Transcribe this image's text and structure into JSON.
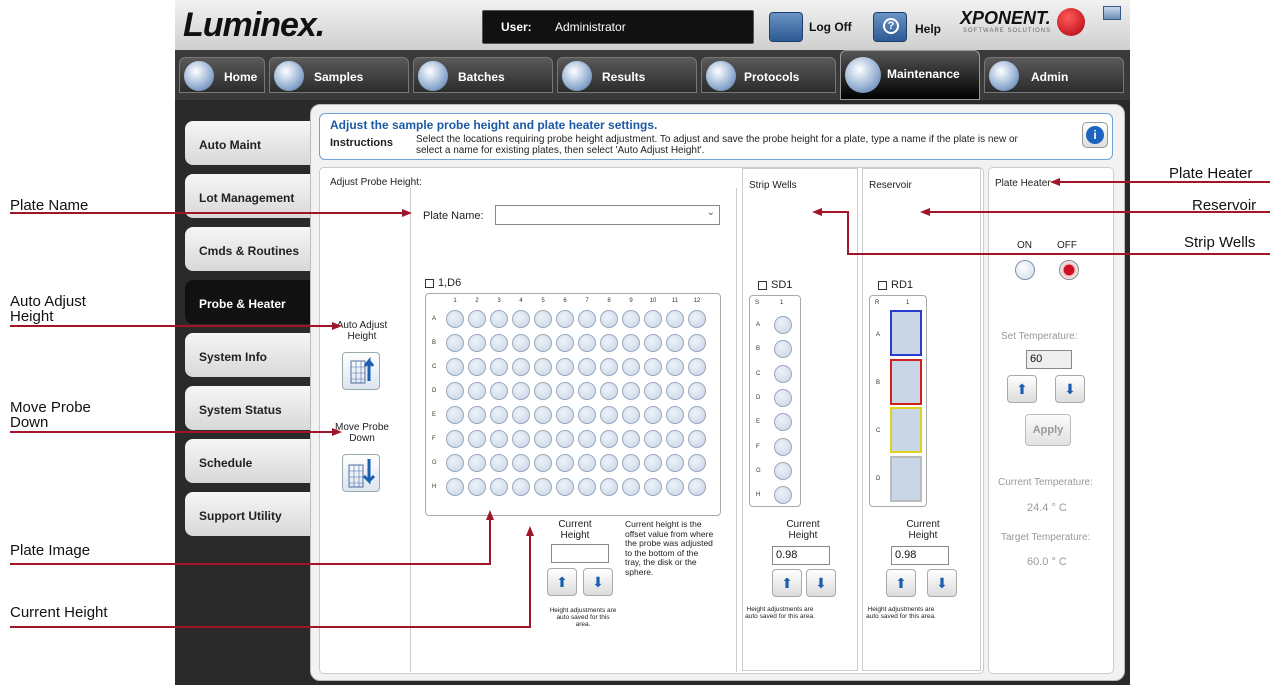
{
  "app": {
    "logo": "Luminex.",
    "brand": "XPONENT.",
    "brand_sub": "SOFTWARE SOLUTIONS"
  },
  "header": {
    "user_label": "User:",
    "user_value": "Administrator",
    "logoff": "Log Off",
    "help": "Help"
  },
  "tabs": [
    {
      "label": "Home",
      "icon": "home-icon"
    },
    {
      "label": "Samples",
      "icon": "samples-icon"
    },
    {
      "label": "Batches",
      "icon": "batches-icon"
    },
    {
      "label": "Results",
      "icon": "results-icon"
    },
    {
      "label": "Protocols",
      "icon": "protocols-icon"
    },
    {
      "label": "Maintenance",
      "icon": "maintenance-icon",
      "active": true
    },
    {
      "label": "Admin",
      "icon": "admin-icon"
    }
  ],
  "sidebar": {
    "items": [
      {
        "label": "Auto Maint"
      },
      {
        "label": "Lot Management"
      },
      {
        "label": "Cmds & Routines"
      },
      {
        "label": "Probe & Heater",
        "active": true
      },
      {
        "label": "System Info"
      },
      {
        "label": "System Status"
      },
      {
        "label": "Schedule"
      },
      {
        "label": "Support Utility"
      }
    ]
  },
  "instructions": {
    "title": "Adjust the sample probe height and plate heater settings.",
    "label": "Instructions",
    "text": "Select the locations requiring probe height adjustment. To adjust and save the probe height for a plate, type a name if the plate is new or select a name for existing plates, then select 'Auto Adjust Height'."
  },
  "adjust": {
    "title": "Adjust Probe Height:",
    "auto_adjust": "Auto Adjust Height",
    "move_down": "Move Probe Down",
    "plate_name_label": "Plate Name:",
    "plate_name_value": "",
    "plate_checkbox": "1,D6",
    "columns": [
      "1",
      "2",
      "3",
      "4",
      "5",
      "6",
      "7",
      "8",
      "9",
      "10",
      "11",
      "12"
    ],
    "rows": [
      "A",
      "B",
      "C",
      "D",
      "E",
      "F",
      "G",
      "H"
    ],
    "current_height_label": "Current Height",
    "current_height_value": "",
    "height_note": "Current height is the offset value from where the probe was adjusted to the bottom of the tray, the disk or the sphere.",
    "autosave_note": "Height adjustments are auto saved for this area."
  },
  "strip": {
    "title": "Strip Wells",
    "checkbox": "SD1",
    "col_s": "S",
    "col_1": "1",
    "rows": [
      "A",
      "B",
      "C",
      "D",
      "E",
      "F",
      "G",
      "H"
    ],
    "current_height_label": "Current Height",
    "current_height_value": "0.98",
    "autosave_note": "Height adjustments are auto saved for this area."
  },
  "reservoir": {
    "title": "Reservoir",
    "checkbox": "RD1",
    "col_r": "R",
    "col_1": "1",
    "rows": [
      "A",
      "B",
      "C",
      "D"
    ],
    "current_height_label": "Current Height",
    "current_height_value": "0.98",
    "autosave_note": "Height adjustments are auto saved for this area."
  },
  "heater": {
    "title": "Plate Heater",
    "on": "ON",
    "off": "OFF",
    "set_temp_label": "Set Temperature:",
    "set_temp_value": "60",
    "apply": "Apply",
    "current_temp_label": "Current Temperature:",
    "current_temp_value": "24.4 ° C",
    "target_temp_label": "Target Temperature:",
    "target_temp_value": "60.0 ° C"
  },
  "callouts": {
    "plate_name": "Plate Name",
    "auto_adjust": "Auto Adjust Height",
    "move_down": "Move Probe Down",
    "plate_image": "Plate Image",
    "current_height": "Current Height",
    "plate_heater": "Plate Heater",
    "reservoir": "Reservoir",
    "strip_wells": "Strip Wells"
  },
  "colors": {
    "accent": "#1c5aa6",
    "callout_line": "#a0152a",
    "reservoir_a": "#2a3bd0",
    "reservoir_b": "#d02020",
    "reservoir_c": "#e0d020"
  }
}
